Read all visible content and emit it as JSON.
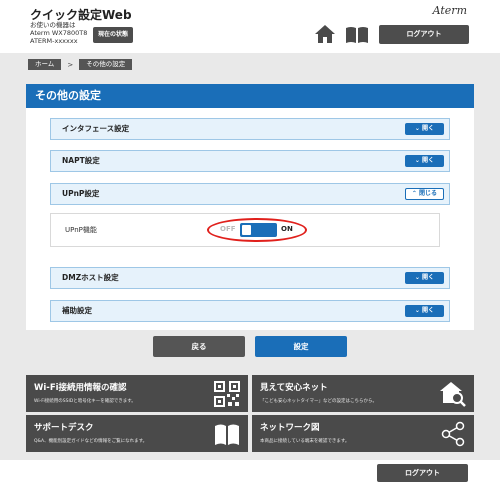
{
  "header": {
    "app_title": "クイック設定Web",
    "device_caption": "お使いの機器は",
    "device_model": "Aterm WX7800T8",
    "device_id": "ATERM-xxxxxx",
    "status_button": "現在の状態",
    "brand": "Aterm",
    "logout": "ログアウト",
    "icons": [
      "home-icon",
      "manual-book-icon"
    ]
  },
  "breadcrumb": {
    "items": [
      "ホーム",
      "その他の設定"
    ],
    "separator": ">"
  },
  "panel": {
    "title": "その他の設定",
    "sections": [
      {
        "label": "インタフェース設定",
        "button": "開く",
        "expanded": false
      },
      {
        "label": "NAPT設定",
        "button": "開く",
        "expanded": false
      },
      {
        "label": "UPnP設定",
        "button": "閉じる",
        "expanded": true
      },
      {
        "label": "DMZホスト設定",
        "button": "開く",
        "expanded": false
      },
      {
        "label": "補助設定",
        "button": "開く",
        "expanded": false
      }
    ],
    "upnp": {
      "label": "UPnP機能",
      "off_label": "OFF",
      "on_label": "ON",
      "state": "on"
    }
  },
  "actions": {
    "back": "戻る",
    "save": "設定"
  },
  "tiles": [
    {
      "title": "Wi-Fi接続用情報の確認",
      "desc": "Wi-Fi接続用のSSIDと暗号化キーを確認できます。",
      "icon": "qr-code-icon"
    },
    {
      "title": "見えて安心ネット",
      "desc": "「こども安心ネットタイマー」などの設定はこちらから。",
      "icon": "home-search-icon"
    },
    {
      "title": "サポートデスク",
      "desc": "Q&A、機能別設定ガイドなどの情報をご覧になれます。",
      "icon": "book-icon"
    },
    {
      "title": "ネットワーク図",
      "desc": "本商品に接続している端末を確認できます。",
      "icon": "network-share-icon"
    }
  ],
  "footer": {
    "logout": "ログアウト"
  },
  "colors": {
    "accent": "#1a6eb8",
    "dark_button": "#4d4d4d",
    "highlight_ring": "#e0201c",
    "accordion_bg": "#e6f2fb"
  }
}
